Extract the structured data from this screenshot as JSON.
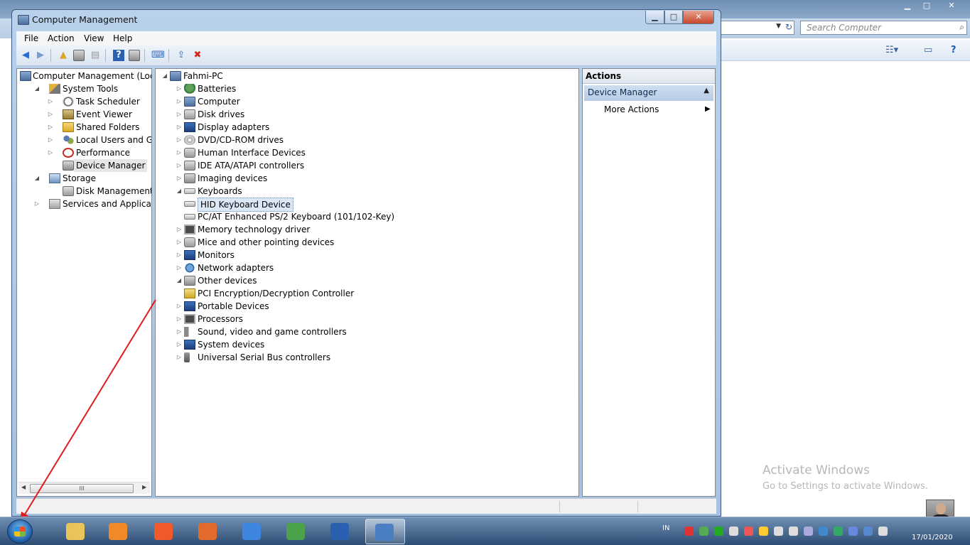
{
  "window": {
    "title": "Computer Management",
    "min_glyph": "▁",
    "max_glyph": "□",
    "close_glyph": "✕"
  },
  "menu": [
    "File",
    "Action",
    "View",
    "Help"
  ],
  "background_window": {
    "search_placeholder": "Search Computer",
    "controls": [
      "▁",
      "□",
      "✕"
    ]
  },
  "left_tree": [
    {
      "label": "Computer Management (Local",
      "expander": "",
      "icon": "computer-management-icon"
    },
    {
      "label": "System Tools",
      "expander": "◢",
      "icon": "tools-icon"
    },
    {
      "label": "Task Scheduler",
      "expander": "▷",
      "icon": "clock-icon"
    },
    {
      "label": "Event Viewer",
      "expander": "▷",
      "icon": "event-log-icon"
    },
    {
      "label": "Shared Folders",
      "expander": "▷",
      "icon": "shared-folder-icon"
    },
    {
      "label": "Local Users and Groups",
      "expander": "▷",
      "icon": "users-icon"
    },
    {
      "label": "Performance",
      "expander": "▷",
      "icon": "performance-icon"
    },
    {
      "label": "Device Manager",
      "expander": "",
      "icon": "device-manager-icon",
      "selected": true
    },
    {
      "label": "Storage",
      "expander": "◢",
      "icon": "storage-icon"
    },
    {
      "label": "Disk Management",
      "expander": "",
      "icon": "disk-icon"
    },
    {
      "label": "Services and Applications",
      "expander": "▷",
      "icon": "services-icon"
    }
  ],
  "device_tree": [
    {
      "label": "Fahmi-PC",
      "expander": "◢",
      "icon": "computer-icon"
    },
    {
      "label": "Batteries",
      "expander": "▷",
      "icon": "battery-icon"
    },
    {
      "label": "Computer",
      "expander": "▷",
      "icon": "computer-icon"
    },
    {
      "label": "Disk drives",
      "expander": "▷",
      "icon": "disk-drive-icon"
    },
    {
      "label": "Display adapters",
      "expander": "▷",
      "icon": "display-adapter-icon"
    },
    {
      "label": "DVD/CD-ROM drives",
      "expander": "▷",
      "icon": "dvd-icon"
    },
    {
      "label": "Human Interface Devices",
      "expander": "▷",
      "icon": "hid-icon"
    },
    {
      "label": "IDE ATA/ATAPI controllers",
      "expander": "▷",
      "icon": "ide-controller-icon"
    },
    {
      "label": "Imaging devices",
      "expander": "▷",
      "icon": "imaging-icon"
    },
    {
      "label": "Keyboards",
      "expander": "◢",
      "icon": "keyboard-icon"
    },
    {
      "label": "HID Keyboard Device",
      "expander": "",
      "icon": "keyboard-icon",
      "selected": true
    },
    {
      "label": "PC/AT Enhanced PS/2 Keyboard (101/102-Key)",
      "expander": "",
      "icon": "keyboard-icon"
    },
    {
      "label": "Memory technology driver",
      "expander": "▷",
      "icon": "memory-icon"
    },
    {
      "label": "Mice and other pointing devices",
      "expander": "▷",
      "icon": "mouse-icon"
    },
    {
      "label": "Monitors",
      "expander": "▷",
      "icon": "monitor-icon"
    },
    {
      "label": "Network adapters",
      "expander": "▷",
      "icon": "network-icon"
    },
    {
      "label": "Other devices",
      "expander": "◢",
      "icon": "unknown-device-icon"
    },
    {
      "label": "PCI Encryption/Decryption Controller",
      "expander": "",
      "icon": "warning-device-icon"
    },
    {
      "label": "Portable Devices",
      "expander": "▷",
      "icon": "portable-device-icon"
    },
    {
      "label": "Processors",
      "expander": "▷",
      "icon": "processor-icon"
    },
    {
      "label": "Sound, video and game controllers",
      "expander": "▷",
      "icon": "sound-icon"
    },
    {
      "label": "System devices",
      "expander": "▷",
      "icon": "system-device-icon"
    },
    {
      "label": "Universal Serial Bus controllers",
      "expander": "▷",
      "icon": "usb-icon"
    }
  ],
  "actions": {
    "header": "Actions",
    "section": "Device Manager",
    "more": "More Actions"
  },
  "scroll_thumb": "III",
  "watermark": {
    "line1": "Activate Windows",
    "line2": "Go to Settings to activate Windows."
  },
  "taskbar": {
    "lang": "IN",
    "date": "17/01/2020",
    "apps": [
      {
        "name": "file-explorer",
        "color": "#e9c45a"
      },
      {
        "name": "media-player",
        "color": "#f08a28"
      },
      {
        "name": "screen-recorder",
        "color": "#f05a2a"
      },
      {
        "name": "presentation-app",
        "color": "#e26a2a"
      },
      {
        "name": "chrome-browser",
        "color": "#3f86e0"
      },
      {
        "name": "camtasia",
        "color": "#4aa24a"
      },
      {
        "name": "word",
        "color": "#2b5fb0"
      },
      {
        "name": "computer-management",
        "color": "#4a7fc2",
        "active": true
      }
    ],
    "tray_colors": [
      "#d33",
      "#5a5",
      "#2a2",
      "#ddd",
      "#e55",
      "#fc3",
      "#ddd",
      "#ddd",
      "#aad",
      "#48c",
      "#3a6",
      "#68d",
      "#58c",
      "#ddd"
    ]
  },
  "colors": {
    "titlebar": "#b9d1ea",
    "selection_bg": "#dde8f7",
    "annotation_arrow": "#e01b1b"
  }
}
